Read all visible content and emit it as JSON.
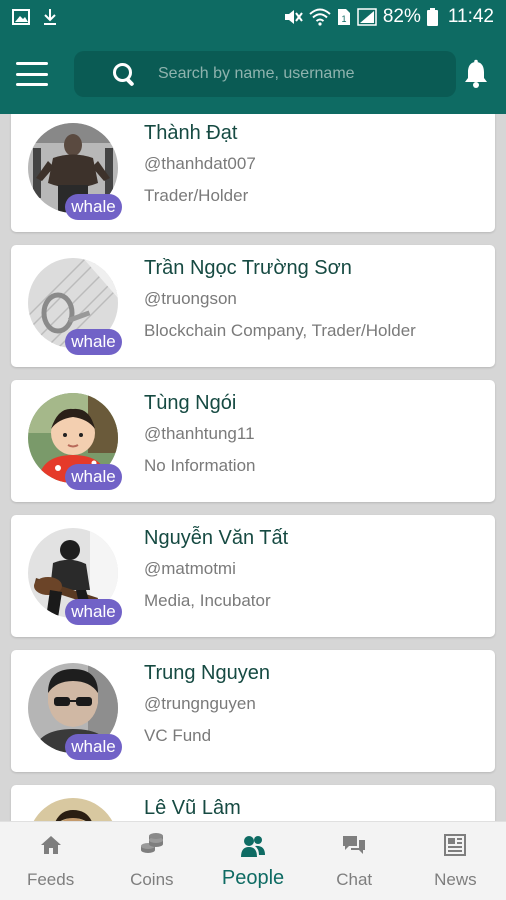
{
  "status_bar": {
    "battery": "82%",
    "time": "11:42",
    "icons": [
      "image-icon",
      "download-icon",
      "mute-icon",
      "wifi-icon",
      "signal-icon",
      "battery-icon"
    ]
  },
  "header": {
    "menu_icon": "hamburger-menu-icon",
    "search_placeholder": "Search by name, username",
    "search_value": "",
    "notification_icon": "bell-icon",
    "colors": {
      "primary": "#0e6b63",
      "search_bg": "#0a5b54"
    }
  },
  "people": [
    {
      "name": "Thành Đạt",
      "username": "@thanhdat007",
      "bio": "Trader/Holder",
      "badge": "whale"
    },
    {
      "name": "Trần Ngọc Trường Sơn",
      "username": "@truongson",
      "bio": "Blockchain Company, Trader/Holder",
      "badge": "whale"
    },
    {
      "name": "Tùng Ngói",
      "username": "@thanhtung11",
      "bio": "No Information",
      "badge": "whale"
    },
    {
      "name": "Nguyễn Văn Tất",
      "username": "@matmotmi",
      "bio": "Media, Incubator",
      "badge": "whale"
    },
    {
      "name": "Trung Nguyen",
      "username": "@trungnguyen",
      "bio": "VC Fund",
      "badge": "whale"
    },
    {
      "name": "Lê Vũ Lâm",
      "username": "",
      "bio": "",
      "badge": ""
    }
  ],
  "badge_color": "#7162c7",
  "bottom_nav": [
    {
      "label": "Feeds",
      "icon": "home-icon",
      "active": false
    },
    {
      "label": "Coins",
      "icon": "coins-icon",
      "active": false
    },
    {
      "label": "People",
      "icon": "people-icon",
      "active": true
    },
    {
      "label": "Chat",
      "icon": "chat-icon",
      "active": false
    },
    {
      "label": "News",
      "icon": "news-icon",
      "active": false
    }
  ]
}
